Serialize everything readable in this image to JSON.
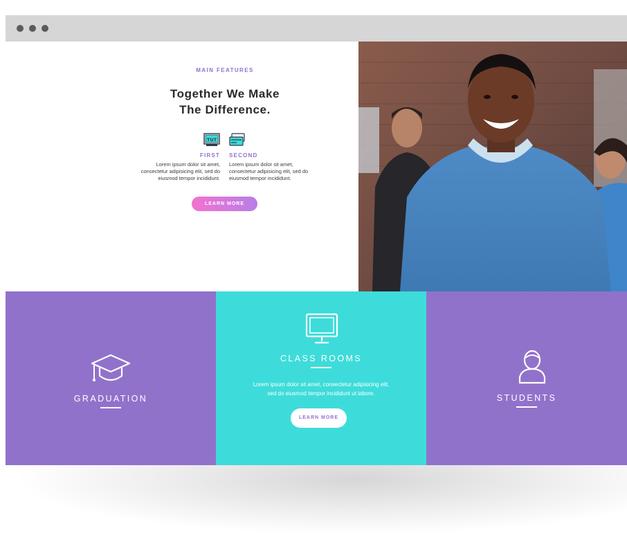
{
  "features_section": {
    "eyebrow": "MAIN FEATURES",
    "headline_line1": "Together We Make",
    "headline_line2": "The Difference.",
    "features": [
      {
        "icon": "tut-screen-icon",
        "label": "FIRST",
        "text": "Lorem ipsum dolor sit amet, consectetur adipisicing elit, sed do eiusmod tempor incididunt."
      },
      {
        "icon": "cards-icon",
        "label": "SECOND",
        "text": "Lorem ipsum dolor sit amet, consectetur adipisicing elit, sed do eiusmod tempor incididunt."
      }
    ],
    "button_label": "LEARN MORE",
    "icon_badge_text": "TUT"
  },
  "tiles": [
    {
      "icon": "graduation-cap-icon",
      "title": "GRADUATION"
    },
    {
      "icon": "monitor-icon",
      "title": "CLASS ROOMS",
      "text_line1": "Lorem ipsum dolor sit amet, consectetur adipisicing elit,",
      "text_line2": "sed do eiusmod tempor incididunt ut labore.",
      "button_label": "LEARN MORE"
    },
    {
      "icon": "student-icon",
      "title": "STUDENTS"
    }
  ],
  "colors": {
    "purple": "#9172cb",
    "cyan": "#3ddcda",
    "pink": "#f472d0",
    "titlebar": "#d6d6d6"
  }
}
